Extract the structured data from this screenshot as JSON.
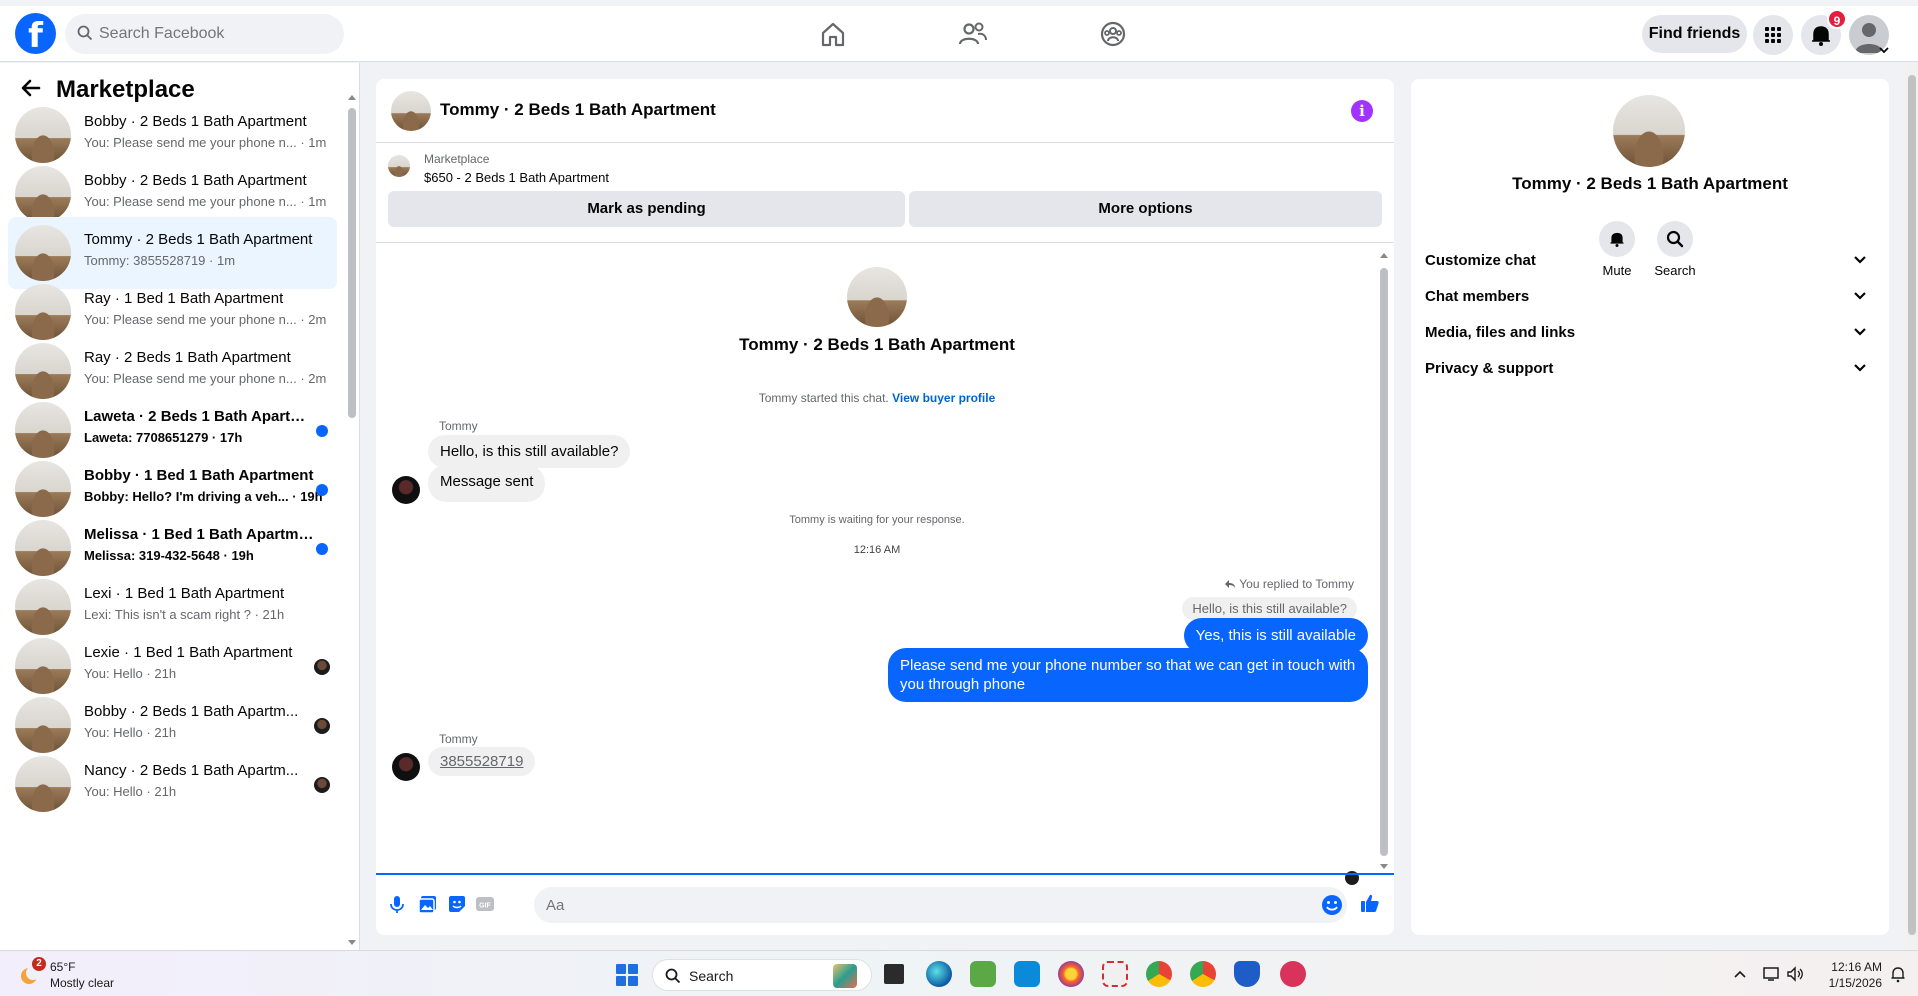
{
  "topbar": {
    "logo": "f",
    "search_placeholder": "Search Facebook",
    "find_friends": "Find friends",
    "notifications_count": "9"
  },
  "sidebar": {
    "title": "Marketplace",
    "conversations": [
      {
        "name": "Bobby · 2 Beds 1 Bath Apartment",
        "preview": "You: Please send me your phone n...",
        "time": "1m",
        "unread": false,
        "indicator": "none"
      },
      {
        "name": "Bobby · 2 Beds 1 Bath Apartment",
        "preview": "You: Please send me your phone n...",
        "time": "1m",
        "unread": false,
        "indicator": "none"
      },
      {
        "name": "Tommy · 2 Beds 1 Bath Apartment",
        "preview": "Tommy: 3855528719",
        "time": "1m",
        "unread": false,
        "indicator": "none",
        "active": true
      },
      {
        "name": "Ray · 1 Bed 1 Bath Apartment",
        "preview": "You: Please send me your phone n...",
        "time": "2m",
        "unread": false,
        "indicator": "none"
      },
      {
        "name": "Ray · 2 Beds 1 Bath Apartment",
        "preview": "You: Please send me your phone n...",
        "time": "2m",
        "unread": false,
        "indicator": "none"
      },
      {
        "name": "Laweta · 2 Beds 1 Bath Apartm...",
        "preview": "Laweta: 7708651279",
        "time": "17h",
        "unread": true,
        "indicator": "dot"
      },
      {
        "name": "Bobby · 1 Bed 1 Bath Apartment",
        "preview": "Bobby: Hello? I'm driving a veh...",
        "time": "19h",
        "unread": true,
        "indicator": "dot"
      },
      {
        "name": "Melissa · 1 Bed 1 Bath Apartme...",
        "preview": "Melissa: 319-432-5648",
        "time": "19h",
        "unread": true,
        "indicator": "dot"
      },
      {
        "name": "Lexi · 1 Bed 1 Bath Apartment",
        "preview": "Lexi: This isn't a scam right ?",
        "time": "21h",
        "unread": false,
        "indicator": "none"
      },
      {
        "name": "Lexie · 1 Bed 1 Bath Apartment",
        "preview": "You: Hello",
        "time": "21h",
        "unread": false,
        "indicator": "avatar"
      },
      {
        "name": "Bobby · 2 Beds 1 Bath Apartm...",
        "preview": "You: Hello",
        "time": "21h",
        "unread": false,
        "indicator": "avatar"
      },
      {
        "name": "Nancy · 2 Beds 1 Bath Apartm...",
        "preview": "You: Hello",
        "time": "21h",
        "unread": false,
        "indicator": "avatar"
      }
    ]
  },
  "chat": {
    "title": "Tommy · 2 Beds 1 Bath Apartment",
    "listing_category": "Marketplace",
    "listing_price_title": "$650 - 2 Beds 1 Bath Apartment",
    "mark_pending": "Mark as pending",
    "more_options": "More options",
    "hero_name": "Tommy · 2 Beds 1 Bath Apartment",
    "started_text": "Tommy started this chat.",
    "buyer_profile_link": "View buyer profile",
    "sender_name_1": "Tommy",
    "msg_in_1": "Hello, is this still available?",
    "msg_in_2": "Message sent",
    "waiting_text": "Tommy is waiting for your response.",
    "timestamp": "12:16 AM",
    "replied_to": "You replied to Tommy",
    "quoted": "Hello, is this still available?",
    "msg_out_1": "Yes, this is still available",
    "msg_out_2": "Please send me your phone  number so that we can get in touch with you through phone",
    "sender_name_2": "Tommy",
    "msg_in_3": "3855528719",
    "composer_placeholder": "Aa"
  },
  "rpanel": {
    "name": "Tommy · 2 Beds 1 Bath Apartment",
    "mute": "Mute",
    "search": "Search",
    "sections": [
      "Customize chat",
      "Chat members",
      "Media, files and links",
      "Privacy & support"
    ]
  },
  "taskbar": {
    "weather_badge": "2",
    "temperature": "65°F",
    "condition": "Mostly clear",
    "search_label": "Search",
    "time": "12:16 AM",
    "date": "1/15/2026"
  },
  "colors": {
    "brand": "#0866ff",
    "info": "#a033ff",
    "notification": "#e41e3f"
  }
}
